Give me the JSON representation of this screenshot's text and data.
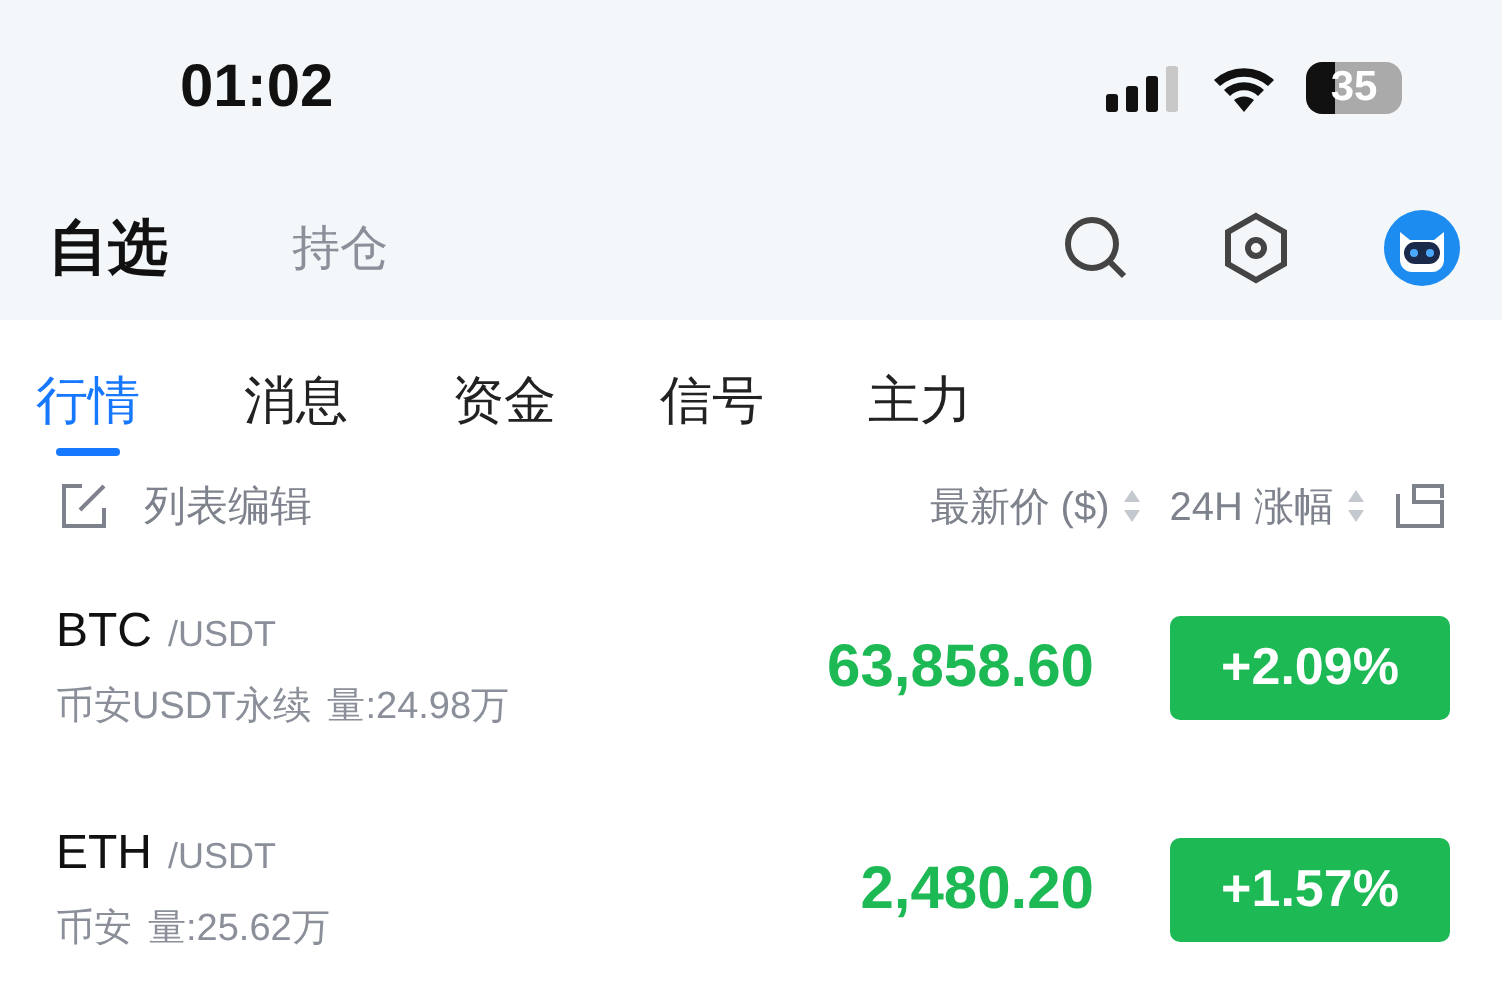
{
  "status_bar": {
    "time": "01:02",
    "battery": "35"
  },
  "top_tabs": [
    {
      "label": "自选",
      "selected": true
    },
    {
      "label": "持仓",
      "selected": false
    }
  ],
  "sub_tabs": [
    {
      "label": "行情",
      "selected": true
    },
    {
      "label": "消息",
      "selected": false
    },
    {
      "label": "资金",
      "selected": false
    },
    {
      "label": "信号",
      "selected": false
    },
    {
      "label": "主力",
      "selected": false
    }
  ],
  "list_header": {
    "edit_label": "列表编辑",
    "columns": [
      "最新价 ($)",
      "24H 涨幅"
    ]
  },
  "rows": [
    {
      "symbol": "BTC",
      "quote": "/USDT",
      "exchange": "币安USDT永续",
      "volume": "量:24.98万",
      "price": "63,858.60",
      "change": "+2.09%"
    },
    {
      "symbol": "ETH",
      "quote": "/USDT",
      "exchange": "币安",
      "volume": "量:25.62万",
      "price": "2,480.20",
      "change": "+1.57%"
    }
  ]
}
